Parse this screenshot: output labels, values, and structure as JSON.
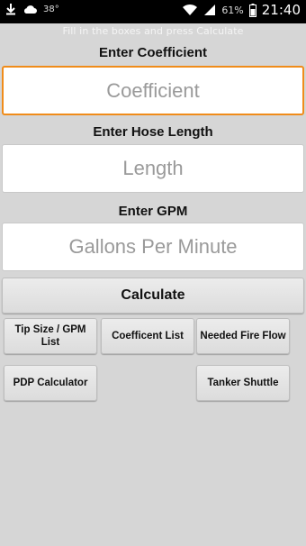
{
  "status_bar": {
    "temperature": "38°",
    "battery_percent": "61%",
    "time": "21:40",
    "icons": [
      "download-icon",
      "cloud-icon",
      "wifi-icon",
      "signal-icon",
      "battery-icon"
    ]
  },
  "hint": "Fill in the boxes and press Calculate",
  "coefficient": {
    "label": "Enter Coefficient",
    "placeholder": "Coefficient",
    "value": ""
  },
  "hose_length": {
    "label": "Enter Hose Length",
    "placeholder": "Length",
    "value": ""
  },
  "gpm": {
    "label": "Enter GPM",
    "placeholder": "Gallons Per Minute",
    "value": ""
  },
  "buttons": {
    "calculate": "Calculate",
    "tip_size": "Tip Size / GPM List",
    "coefficient_list": "Coefficent List",
    "needed_fire_flow": "Needed Fire Flow",
    "pdp_calculator": "PDP Calculator",
    "tanker_shuttle": "Tanker Shuttle"
  },
  "colors": {
    "focus_border": "#f08c1a",
    "background": "#d6d6d6"
  }
}
